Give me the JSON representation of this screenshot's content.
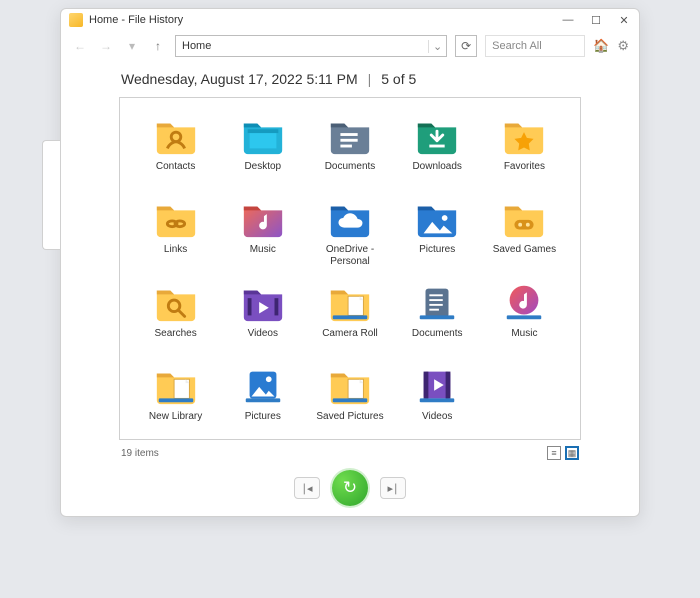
{
  "window": {
    "title": "Home - File History"
  },
  "address": {
    "path": "Home"
  },
  "search": {
    "placeholder": "Search All"
  },
  "header": {
    "timestamp": "Wednesday, August 17, 2022 5:11 PM",
    "position": "5 of 5"
  },
  "status": {
    "item_count": "19 items"
  },
  "items": [
    {
      "label": "Contacts",
      "icon": "contacts"
    },
    {
      "label": "Desktop",
      "icon": "desktop"
    },
    {
      "label": "Documents",
      "icon": "documents-blue"
    },
    {
      "label": "Downloads",
      "icon": "downloads"
    },
    {
      "label": "Favorites",
      "icon": "favorites"
    },
    {
      "label": "Links",
      "icon": "links"
    },
    {
      "label": "Music",
      "icon": "music"
    },
    {
      "label": "OneDrive - Personal",
      "icon": "onedrive"
    },
    {
      "label": "Pictures",
      "icon": "pictures"
    },
    {
      "label": "Saved Games",
      "icon": "games"
    },
    {
      "label": "Searches",
      "icon": "searches"
    },
    {
      "label": "Videos",
      "icon": "videos"
    },
    {
      "label": "Camera Roll",
      "icon": "lib-doc"
    },
    {
      "label": "Documents",
      "icon": "lib-docs"
    },
    {
      "label": "Music",
      "icon": "lib-music"
    },
    {
      "label": "New Library",
      "icon": "lib-doc"
    },
    {
      "label": "Pictures",
      "icon": "lib-pics"
    },
    {
      "label": "Saved Pictures",
      "icon": "lib-doc"
    },
    {
      "label": "Videos",
      "icon": "lib-videos"
    }
  ]
}
